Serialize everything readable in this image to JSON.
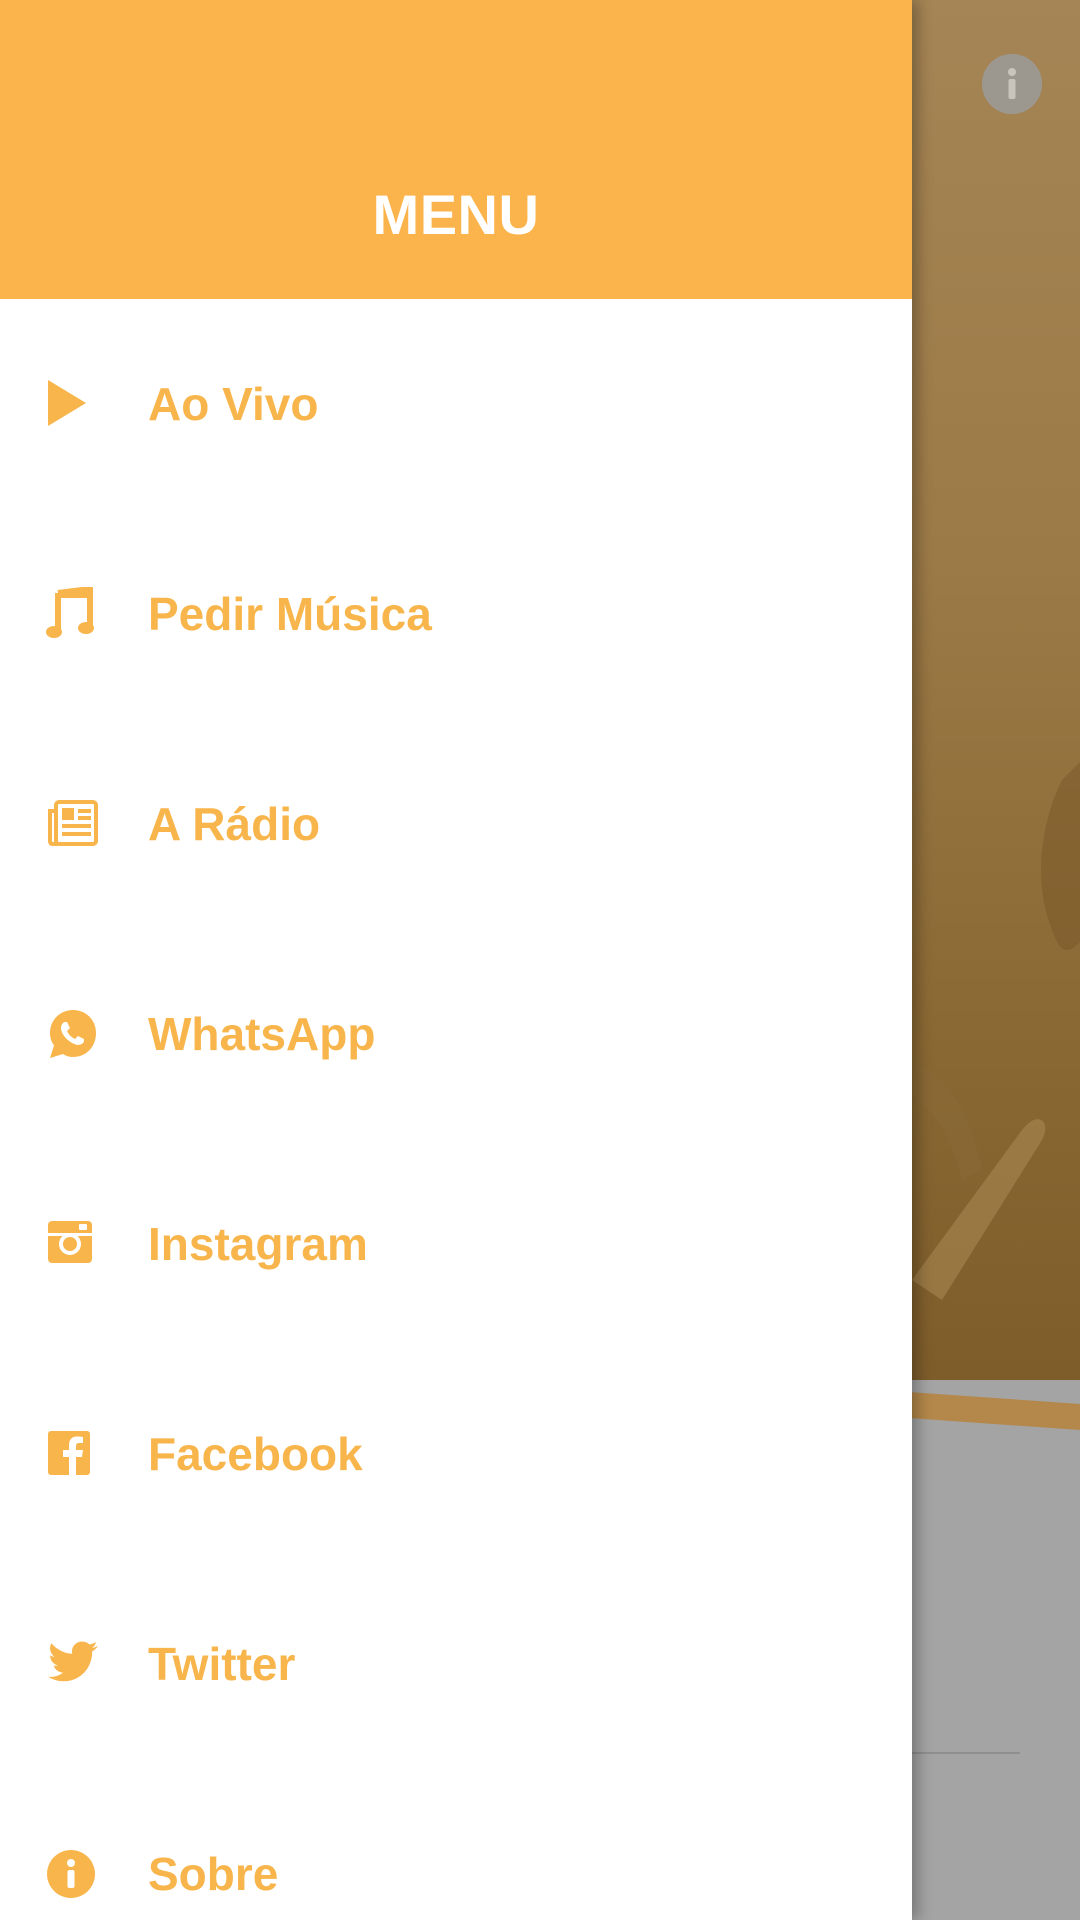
{
  "drawer": {
    "title": "MENU",
    "items": [
      {
        "icon": "play-icon",
        "label": "Ao Vivo"
      },
      {
        "icon": "music-note-icon",
        "label": "Pedir Música"
      },
      {
        "icon": "newspaper-icon",
        "label": "A Rádio"
      },
      {
        "icon": "whatsapp-icon",
        "label": "WhatsApp"
      },
      {
        "icon": "instagram-icon",
        "label": "Instagram"
      },
      {
        "icon": "facebook-icon",
        "label": "Facebook"
      },
      {
        "icon": "twitter-icon",
        "label": "Twitter"
      },
      {
        "icon": "info-icon",
        "label": "Sobre"
      }
    ]
  },
  "background": {
    "info_button_icon": "info-icon"
  },
  "colors": {
    "accent": "#fbb34b",
    "menu_text": "#f8b54b",
    "drawer_bg": "#ffffff"
  }
}
